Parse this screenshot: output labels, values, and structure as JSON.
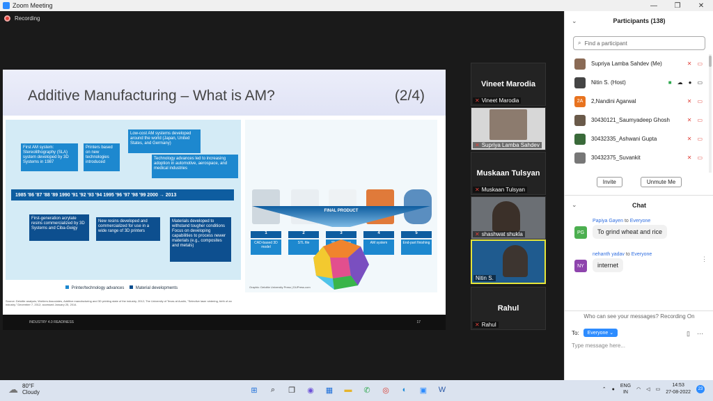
{
  "window": {
    "title": "Zoom Meeting",
    "minimize": "—",
    "restore": "❐",
    "close": "✕"
  },
  "recording": {
    "label": "Recording"
  },
  "slide": {
    "title": "Additive Manufacturing – What is AM?",
    "page": "(2/4)",
    "boxes": [
      "First AM system: Stereolithography (SLA) system developed by 3D Systems in 1987",
      "Printers based on new technologies introduced",
      "Low-cost AM systems developed around the world (Japan, United States, and Germany)",
      "Technology advances led to increasing adoption in automotive, aerospace, and medical industries",
      "First-generation acrylate resins commercialized by 3D Systems and Ciba-Geigy",
      "New resins developed and commercialized for use in a wide range of 3D printers",
      "Materials developed to withstand tougher conditions\nFocus on developing capabilities to process newer materials (e.g., composites and metals)"
    ],
    "timeline": "1985 '86 '87 '88 '89 1990 '91 '92 '93 '94 1995 '96 '97 '98 '99 2000 → 2013",
    "steps": [
      {
        "num": "1",
        "label": "CAD-based 3D model"
      },
      {
        "num": "2",
        "label": "STL file"
      },
      {
        "num": "3",
        "label": "Sliced layers"
      },
      {
        "num": "4",
        "label": "AM system"
      },
      {
        "num": "5",
        "label": "End-part finishing"
      }
    ],
    "final_product": "FINAL PRODUCT",
    "legend_1": "Printer/technology advances",
    "legend_2": "Material developments",
    "source": "Source: Deloitte analysis; Wohlers Associates, Additive manufacturing and 3D printing state of the industry, 2012; The University of Texas at Austin, \"Selective laser sintering, birth of an industry,\" December 7, 2012; accessed January 25, 2014.",
    "graphic_credit": "Graphic: Deloitte University Press | DUPress.com",
    "footer_left": "INDUSTRY 4.0 READINESS",
    "footer_right": "17"
  },
  "tiles": [
    {
      "big": "Vineet Marodia",
      "label": "Vineet Marodia"
    },
    {
      "big": "",
      "label": "Supriya Lamba  Sahdev"
    },
    {
      "big": "Muskaan Tulsyan",
      "label": "Muskaan Tulsyan"
    },
    {
      "big": "",
      "label": "shashwat shukla"
    },
    {
      "big": "",
      "label": "Nitin S."
    },
    {
      "big": "Rahul",
      "label": "Rahul"
    }
  ],
  "participants": {
    "header": "Participants (138)",
    "search_placeholder": "Find a participant",
    "list": [
      {
        "name": "Supriya Lamba  Sahdev (Me)",
        "avatar": "",
        "color": "#8a6a55"
      },
      {
        "name": "Nitin S. (Host)",
        "avatar": "",
        "color": "#444"
      },
      {
        "name": "2,Nandini Agarwal",
        "avatar": "2A",
        "color": "#e8731f"
      },
      {
        "name": "30430121_Saumyadeep Ghosh",
        "avatar": "",
        "color": "#6a5a4a"
      },
      {
        "name": "30432335_Ashwani Gupta",
        "avatar": "",
        "color": "#3a6a3a"
      },
      {
        "name": "30432375_Suvankit",
        "avatar": "",
        "color": "#777"
      }
    ],
    "invite": "Invite",
    "unmute_me": "Unmute Me"
  },
  "chat": {
    "header": "Chat",
    "messages": [
      {
        "from": "Papiya Gayen",
        "to": "Everyone",
        "avatar": "PG",
        "color": "#4caf50",
        "text": "To grind wheat and rice"
      },
      {
        "from": "nehanth yadav",
        "to": "Everyone",
        "avatar": "NY",
        "color": "#8e44ad",
        "text": "internet"
      }
    ],
    "to_word": "to",
    "who_can_see": "Who can see your messages? Recording On",
    "to_label": "To:",
    "to_value": "Everyone",
    "placeholder": "Type message here..."
  },
  "taskbar": {
    "temp": "80°F",
    "weather": "Cloudy",
    "lang": "ENG",
    "region": "IN",
    "time": "14:53",
    "date": "27-08-2022",
    "notifications": "23"
  },
  "colors": {
    "accent": "#2d8cff",
    "muted_red": "#e0413a",
    "active_tile": "#e6e63a"
  }
}
